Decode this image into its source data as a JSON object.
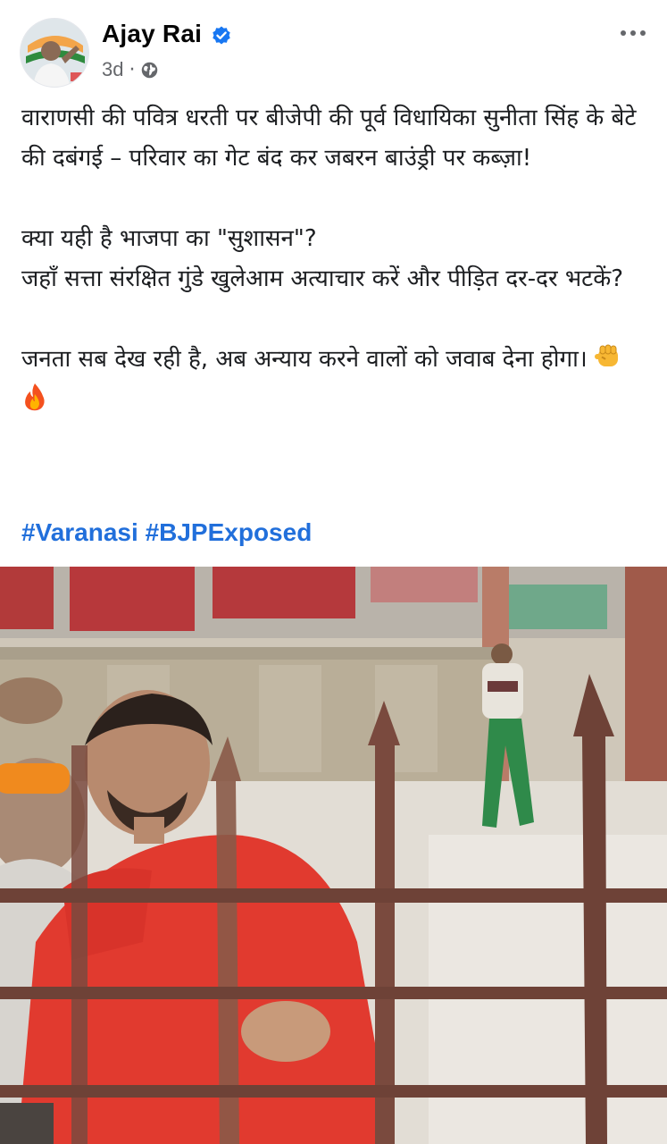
{
  "author": {
    "name": "Ajay Rai",
    "verified_icon": "verified-badge-icon",
    "time": "3d",
    "separator": "·",
    "audience_icon": "globe-icon"
  },
  "actions": {
    "more_icon": "more-dots-icon"
  },
  "post": {
    "paragraphs": [
      "वाराणसी की पवित्र धरती पर बीजेपी की पूर्व विधायिका सुनीता सिंह के बेटे की दबंगई – परिवार का गेट बंद कर जबरन बाउंड्री पर कब्ज़ा!",
      "क्या यही है भाजपा का \"सुशासन\"?",
      "जहाँ सत्ता संरक्षित गुंडे खुलेआम अत्याचार करें और पीड़ित दर-दर भटकें?",
      "जनता सब देख रही है, अब अन्याय करने वालों को जवाब देना होगा।"
    ],
    "emojis": [
      "fist-emoji",
      "fire-emoji"
    ],
    "hashtags": [
      "#Varanasi",
      "#BJPExposed"
    ]
  },
  "media": {
    "type": "photo"
  },
  "colors": {
    "link": "#216fdb",
    "verified": "#1877f2",
    "meta": "#65676b"
  }
}
